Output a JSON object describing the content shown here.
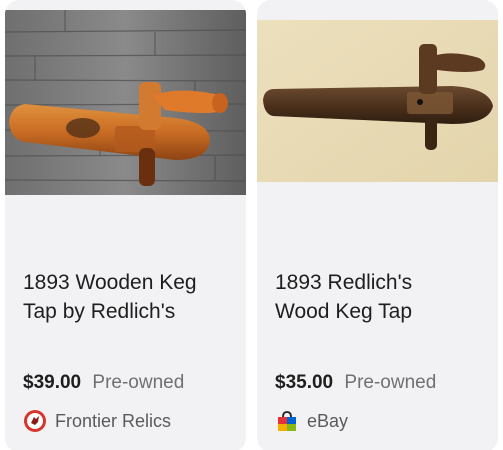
{
  "products": [
    {
      "title_line1": "1893 Wooden Keg",
      "title_line2": "Tap by Redlich's",
      "price": "$39.00",
      "condition": "Pre-owned",
      "seller": "Frontier Relics",
      "seller_icon": "frontier-relics-logo-icon",
      "image": "wooden-keg-tap-on-gray-wood"
    },
    {
      "title_line1": "1893 Redlich's",
      "title_line2": "Wood Keg Tap",
      "price": "$35.00",
      "condition": "Pre-owned",
      "seller": "eBay",
      "seller_icon": "ebay-shopping-bag-icon",
      "image": "wooden-keg-tap-on-beige"
    }
  ],
  "colors": {
    "card_bg": "#f2f2f4",
    "title": "#1e1e1e",
    "condition": "#707070",
    "seller": "#5a5a5a"
  }
}
